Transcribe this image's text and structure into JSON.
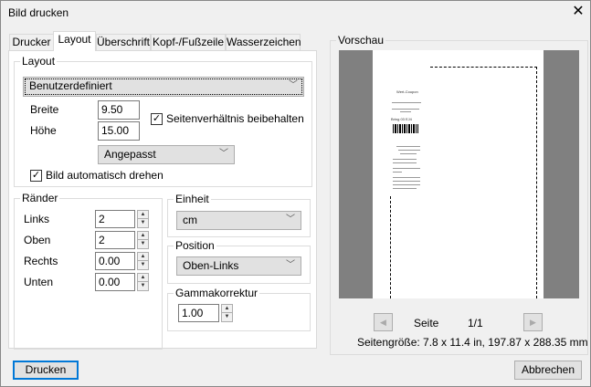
{
  "window": {
    "title": "Bild drucken"
  },
  "tabs": [
    {
      "label": "Drucker"
    },
    {
      "label": "Layout"
    },
    {
      "label": "Überschrift"
    },
    {
      "label": "Kopf-/Fußzeile"
    },
    {
      "label": "Wasserzeichen"
    }
  ],
  "layout": {
    "group": "Layout",
    "preset": "Benutzerdefiniert",
    "width_label": "Breite",
    "width": "9.50",
    "height_label": "Höhe",
    "height": "15.00",
    "keep_ratio_label": "Seitenverhältnis beibehalten",
    "keep_ratio": true,
    "fit": "Angepasst",
    "auto_rotate_label": "Bild automatisch drehen",
    "auto_rotate": true
  },
  "margins": {
    "group": "Ränder",
    "rows": [
      {
        "label": "Links",
        "value": "2"
      },
      {
        "label": "Oben",
        "value": "2"
      },
      {
        "label": "Rechts",
        "value": "0.00"
      },
      {
        "label": "Unten",
        "value": "0.00"
      }
    ]
  },
  "unit": {
    "group": "Einheit",
    "value": "cm"
  },
  "position": {
    "group": "Position",
    "value": "Oben-Links"
  },
  "gamma": {
    "group": "Gammakorrektur",
    "value": "1.00"
  },
  "preview": {
    "group": "Vorschau",
    "page_label": "Seite",
    "page": "1/1",
    "page_size": "Seitengröße: 7.8 x 11.4 in, 197.87 x 288.35 mm",
    "coupon_title": "Wert-Coupon",
    "coupon_code": "Bring 03 EJ4"
  },
  "buttons": {
    "print": "Drucken",
    "cancel": "Abbrechen"
  }
}
